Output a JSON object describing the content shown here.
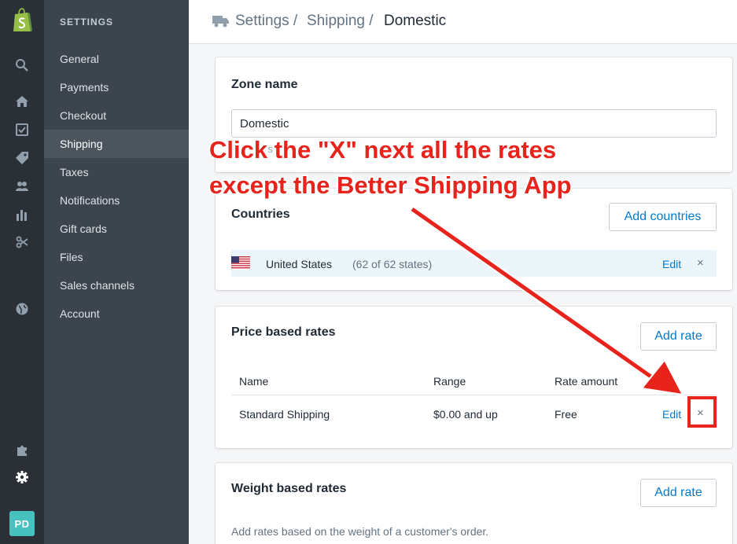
{
  "rail": {
    "icons": [
      "shopify-bag-icon",
      "search-icon",
      "home-icon",
      "orders-icon",
      "tag-icon",
      "customers-icon",
      "reports-icon",
      "discounts-icon",
      "globe-icon",
      "apps-icon",
      "settings-gear-icon"
    ],
    "avatar_initials": "PD",
    "brand_color": "#95bf47"
  },
  "sidebar": {
    "heading": "SETTINGS",
    "items": [
      {
        "label": "General"
      },
      {
        "label": "Payments"
      },
      {
        "label": "Checkout"
      },
      {
        "label": "Shipping",
        "active": true
      },
      {
        "label": "Taxes"
      },
      {
        "label": "Notifications"
      },
      {
        "label": "Gift cards"
      },
      {
        "label": "Files"
      },
      {
        "label": "Sales channels"
      },
      {
        "label": "Account"
      }
    ]
  },
  "breadcrumb": {
    "icon": "truck-icon",
    "settings": "Settings /",
    "shipping": "Shipping /",
    "current": "Domestic"
  },
  "zone": {
    "title": "Zone name",
    "value": "Domestic",
    "help_fragment": "rs",
    "help_fragment2": "ee f"
  },
  "countries": {
    "title": "Countries",
    "add_label": "Add countries",
    "rows": [
      {
        "flag": "us-flag-icon",
        "name": "United States",
        "states": "(62 of 62 states)",
        "edit": "Edit",
        "remove": "×"
      }
    ]
  },
  "price_rates": {
    "title": "Price based rates",
    "add_label": "Add rate",
    "headers": [
      "Name",
      "Range",
      "Rate amount"
    ],
    "rows": [
      {
        "name": "Standard Shipping",
        "range": "$0.00 and up",
        "amount": "Free",
        "edit": "Edit",
        "remove": "×"
      }
    ]
  },
  "weight_rates": {
    "title": "Weight based rates",
    "add_label": "Add rate",
    "description": "Add rates based on the weight of a customer's order."
  },
  "annotation": {
    "line1": "Click the \"X\" next all the rates",
    "line2": "except the Better Shipping App",
    "color": "#e8231c"
  }
}
